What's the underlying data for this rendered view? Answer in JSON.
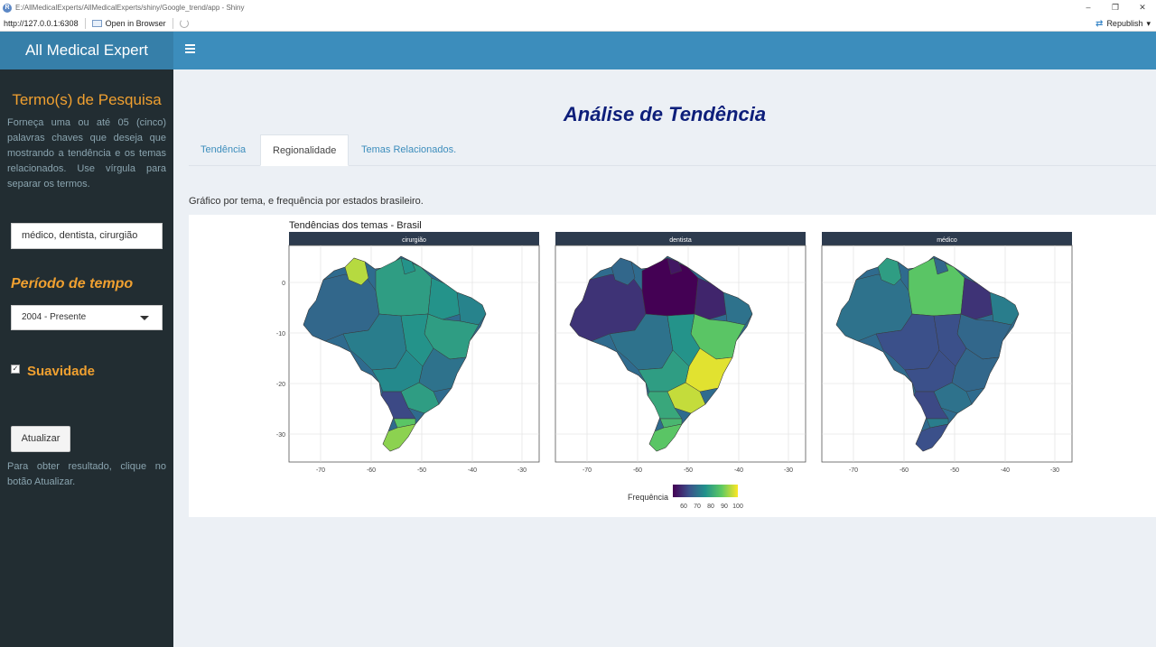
{
  "window": {
    "title": "E:/AllMedicalExperts/AllMedicalExperts/shiny/Google_trend/app - Shiny",
    "url": "http://127.0.0.1:6308",
    "open_in_browser": "Open in Browser",
    "republish": "Republish",
    "minimize": "–",
    "restore": "❐",
    "close": "✕"
  },
  "header": {
    "logo": "All Medical Expert"
  },
  "sidebar": {
    "search_heading": "Termo(s) de Pesquisa",
    "search_help": "Forneça uma ou até 05 (cinco) palavras chaves que deseja que mostrando a tendência e os temas relacionados. Use vírgula para separar os termos.",
    "search_value": "médico, dentista, cirurgião",
    "period_heading": "Período de tempo",
    "period_value": "2004 - Presente",
    "smooth_label": "Suavidade",
    "smooth_checked": "✓",
    "update_button": "Atualizar",
    "update_help": "Para obter resultado, clique no botão Atualizar."
  },
  "main": {
    "title": "Análise de Tendência",
    "tabs": [
      {
        "label": "Tendência"
      },
      {
        "label": "Regionalidade"
      },
      {
        "label": "Temas Relacionados."
      }
    ],
    "active_tab": "Regionalidade",
    "description": "Gráfico por tema, e frequência por estados brasileiro."
  },
  "chart_data": {
    "type": "choropleth-map",
    "title": "Tendências dos temas - Brasil",
    "facets": [
      "cirurgião",
      "dentista",
      "médico"
    ],
    "x_ticks": [
      "-70",
      "-60",
      "-50",
      "-40",
      "-30"
    ],
    "y_ticks": [
      "0",
      "-10",
      "-20",
      "-30"
    ],
    "legend": {
      "title": "Frequência",
      "ticks": [
        "60",
        "70",
        "80",
        "90",
        "100"
      ],
      "range": [
        55,
        100
      ],
      "colors": [
        "#440154",
        "#3b528b",
        "#21918c",
        "#5ec962",
        "#fde725"
      ],
      "placement": "bottom"
    },
    "strip_color": "#2d3b4e"
  }
}
